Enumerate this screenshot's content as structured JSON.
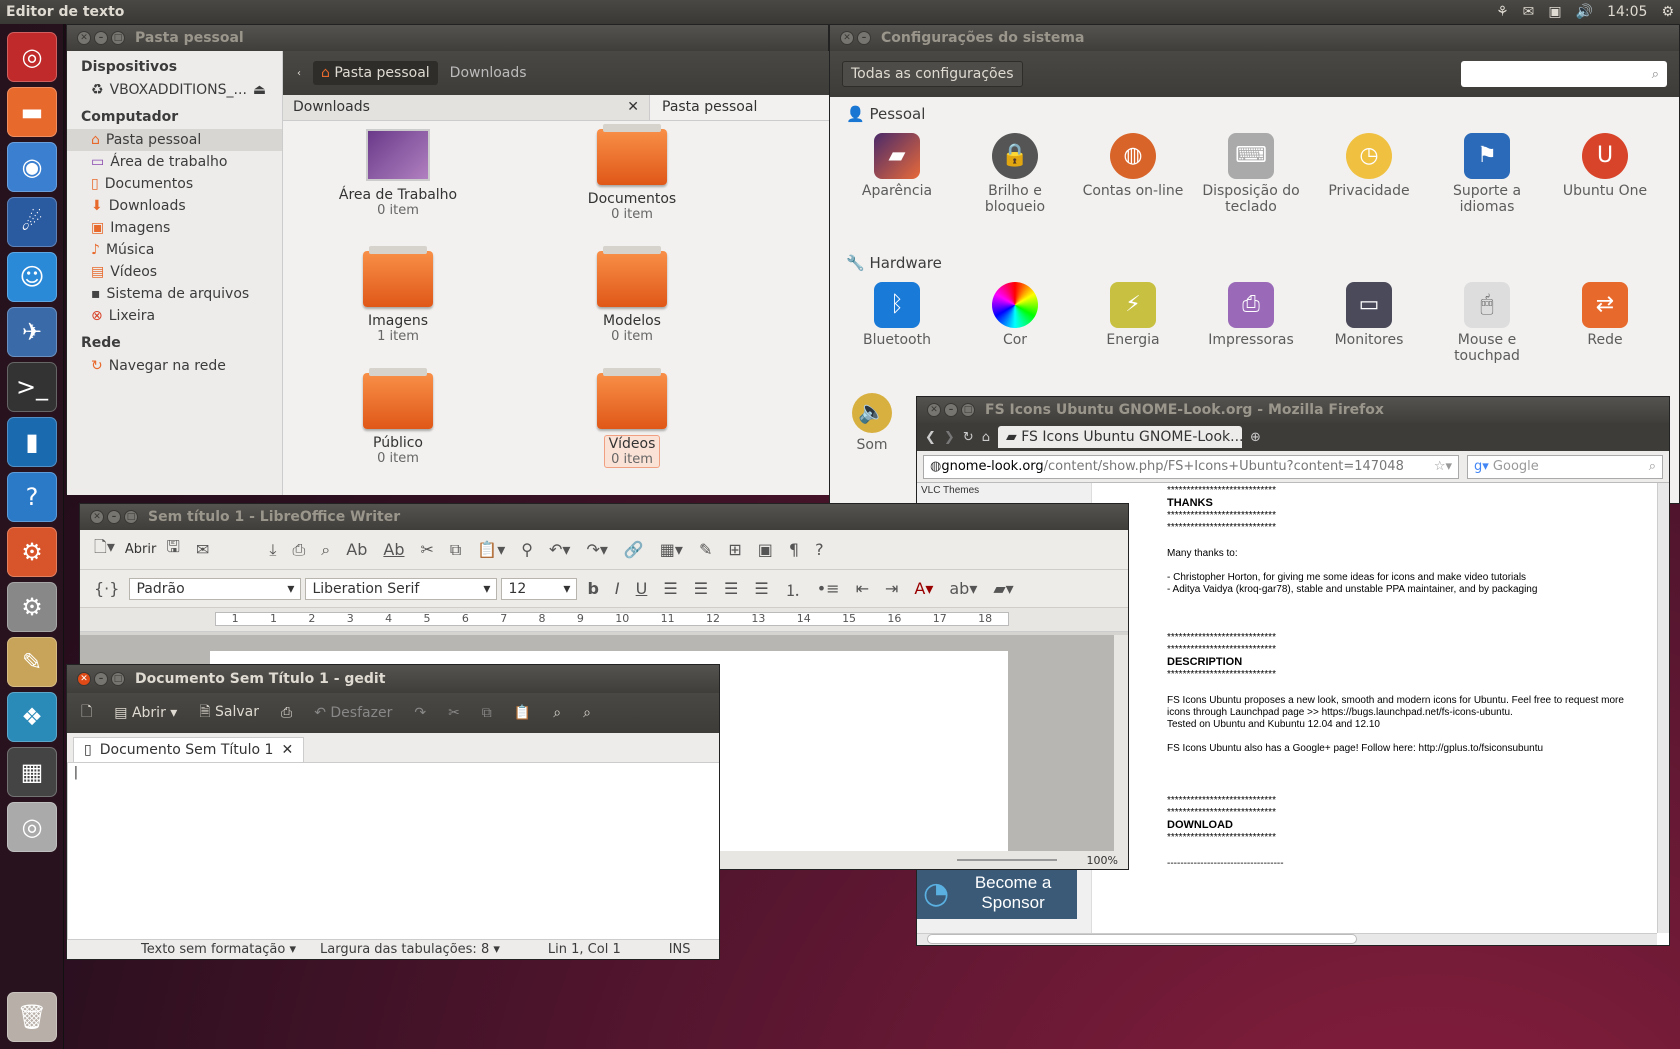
{
  "panel": {
    "app_title": "Editor de texto",
    "time": "14:05"
  },
  "nautilus": {
    "title": "Pasta pessoal",
    "path_buttons": [
      "Pasta pessoal",
      "Downloads"
    ],
    "tabs": [
      "Downloads",
      "Pasta pessoal"
    ],
    "sidebar": {
      "devices_header": "Dispositivos",
      "device": "VBOXADDITIONS_...",
      "computer_header": "Computador",
      "items": [
        "Pasta pessoal",
        "Área de trabalho",
        "Documentos",
        "Downloads",
        "Imagens",
        "Música",
        "Vídeos",
        "Sistema de arquivos",
        "Lixeira"
      ],
      "network_header": "Rede",
      "network_item": "Navegar na rede"
    },
    "files": [
      {
        "name": "Área de Trabalho",
        "count": "0 item"
      },
      {
        "name": "Documentos",
        "count": "0 item"
      },
      {
        "name": "Imagens",
        "count": "1 item"
      },
      {
        "name": "Modelos",
        "count": "0 item"
      },
      {
        "name": "Público",
        "count": "0 item"
      },
      {
        "name": "Vídeos",
        "count": "0 item"
      }
    ]
  },
  "settings": {
    "title": "Configurações do sistema",
    "all_button": "Todas as configurações",
    "personal_header": "Pessoal",
    "personal": [
      "Aparência",
      "Brilho e bloqueio",
      "Contas on-line",
      "Disposição do teclado",
      "Privacidade",
      "Suporte a idiomas",
      "Ubuntu One"
    ],
    "hardware_header": "Hardware",
    "hardware": [
      "Bluetooth",
      "Cor",
      "Energia",
      "Impressoras",
      "Monitores",
      "Mouse e touchpad",
      "Rede"
    ],
    "extra": "Som"
  },
  "firefox": {
    "title": "FS Icons Ubuntu GNOME-Look.org - Mozilla Firefox",
    "tab": "FS Icons Ubuntu GNOME-Look....",
    "url_host": "gnome-look.org",
    "url_path": "/content/show.php/FS+Icons+Ubuntu?content=147048",
    "search_placeholder": "Google",
    "sidebar_link": "VLC Themes",
    "sponsor": "Become a Sponsor",
    "stars": "****************************",
    "thanks": "THANKS",
    "many_thanks": "Many thanks to:",
    "thanks1": "- Christopher Horton, for giving me some ideas for icons and make video tutorials",
    "thanks2": "- Aditya Vaidya (kroq-gar78), stable and unstable PPA maintainer, and by packaging",
    "description": "DESCRIPTION",
    "desc1": "FS Icons Ubuntu proposes a new look, smooth and modern icons for Ubuntu. Feel free to request more",
    "desc2": "icons through Launchpad page >> https://bugs.launchpad.net/fs-icons-ubuntu.",
    "desc3": "Tested on Ubuntu and Kubuntu 12.04 and 12.10",
    "desc4": "FS Icons Ubuntu also has a Google+ page! Follow here: http://gplus.to/fsiconsubuntu",
    "download": "DOWNLOAD",
    "dashes": "-----------------------------------"
  },
  "writer": {
    "title": "Sem título 1 - LibreOffice Writer",
    "open": "Abrir",
    "style": "Padrão",
    "font": "Liberation Serif",
    "size": "12",
    "zoom": "100%",
    "ruler": [
      "1",
      "1",
      "2",
      "3",
      "4",
      "5",
      "6",
      "7",
      "8",
      "9",
      "10",
      "11",
      "12",
      "13",
      "14",
      "15",
      "16",
      "17",
      "18"
    ]
  },
  "gedit": {
    "title": "Documento Sem Título 1 - gedit",
    "open": "Abrir",
    "save": "Salvar",
    "undo": "Desfazer",
    "tab": "Documento Sem Título 1",
    "status_format": "Texto sem formatação",
    "status_tabs": "Largura das tabulações:",
    "status_tabs_val": "8",
    "status_pos": "Lin 1, Col 1",
    "status_ins": "INS"
  },
  "colors": {
    "accent": "#df4a16",
    "panel": "#3c3b37",
    "folder": "#f07030"
  }
}
